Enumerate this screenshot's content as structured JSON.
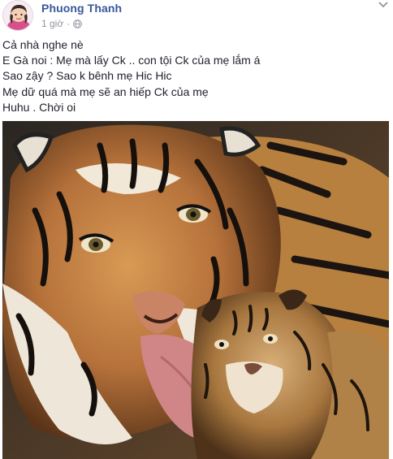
{
  "post": {
    "author_name": "Phuong Thanh",
    "timestamp": "1 giờ",
    "privacy_icon": "globe-icon",
    "menu_icon": "chevron-down-icon",
    "lines": [
      "Cả nhà nghe nè",
      "E Gà noi : Mẹ mà lấy Ck .. con tội Ck của mẹ lắm á",
      "Sao zậy ? Sao k bênh mẹ Hic Hic",
      "Mẹ dữ quá mà mẹ sẽ an hiếp Ck của mẹ",
      "Huhu . Chời oi"
    ],
    "photo_subject": "tiger-mother-licking-cub",
    "colors": {
      "author": "#365899",
      "meta": "#90949c",
      "text": "#1d2129"
    }
  }
}
